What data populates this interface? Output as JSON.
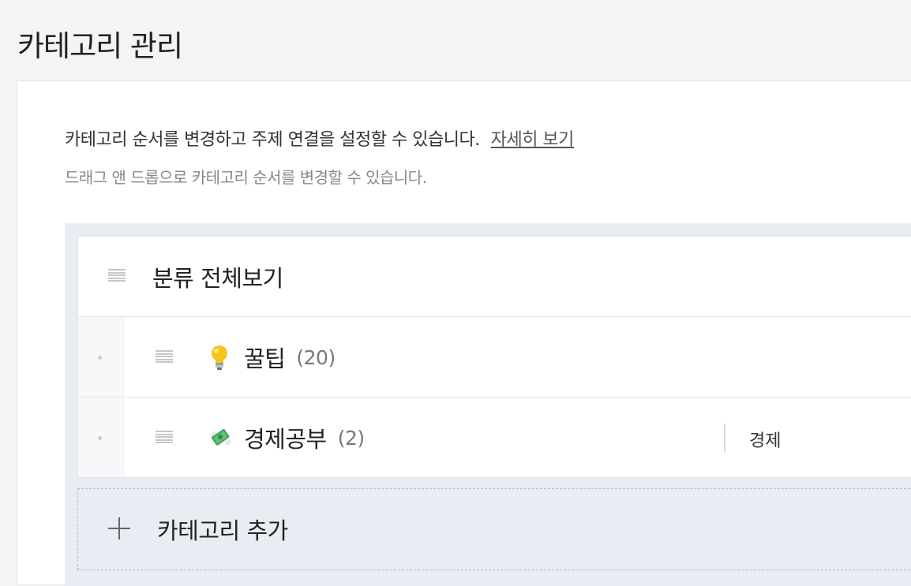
{
  "page": {
    "title": "카테고리 관리"
  },
  "description": {
    "text": "카테고리 순서를 변경하고 주제 연결을 설정할 수 있습니다.",
    "link": "자세히 보기",
    "hint": "드래그 앤 드롭으로 카테고리 순서를 변경할 수 있습니다."
  },
  "categories": {
    "all": {
      "label": "분류 전체보기"
    },
    "items": [
      {
        "icon": "lightbulb-icon",
        "label": "꿀팁",
        "count": "(20)",
        "topic": ""
      },
      {
        "icon": "money-with-wings-icon",
        "label": "경제공부",
        "count": "(2)",
        "topic": "경제"
      }
    ]
  },
  "add": {
    "label": "카테고리 추가"
  },
  "colors": {
    "background": "#f3f4f6",
    "list_background": "#e9ecf2",
    "handle": "#c4c7cc"
  }
}
